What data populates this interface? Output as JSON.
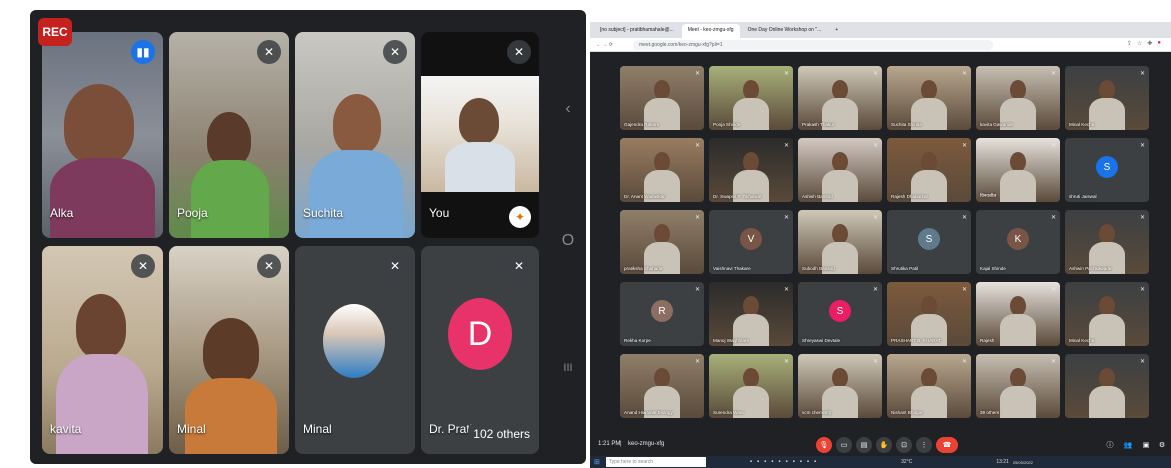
{
  "phone": {
    "rec_label": "REC",
    "tiles": [
      {
        "name": "Alka",
        "icon": "speaking-icon"
      },
      {
        "name": "Pooja",
        "icon": "mic-off-icon"
      },
      {
        "name": "Suchita",
        "icon": "mic-off-icon"
      },
      {
        "name": "You",
        "icon": "mic-off-icon"
      },
      {
        "name": "kavita",
        "icon": "mic-off-icon"
      },
      {
        "name": "Minal",
        "icon": "mic-off-icon"
      },
      {
        "name": "Minal",
        "icon": "mic-off-icon"
      },
      {
        "name": "Dr. Pratib",
        "icon": "mic-off-icon",
        "avatar_letter": "D"
      }
    ],
    "others_label": "102 others",
    "nav": {
      "back": "‹",
      "home": "O",
      "recents": "III"
    }
  },
  "desktop": {
    "tabs": [
      {
        "label": "[no subject] - pratibhamahale@..."
      },
      {
        "label": "Meet - keo-zmgu-xfg",
        "active": true
      },
      {
        "label": "One Day Online Workshop on \"..."
      }
    ],
    "url": "meet.google.com/keo-zmgu-xfg?pli=1",
    "participants": [
      {
        "name": "Gajendra Rahore"
      },
      {
        "name": "Pooja Shinde"
      },
      {
        "name": "Prakash Thakur"
      },
      {
        "name": "Suchita Shinde"
      },
      {
        "name": "kavita Gawande"
      },
      {
        "name": "Minal Keche",
        "avatar_color": "#2f2f2f"
      },
      {
        "name": "Dr. Anant Wadaskar"
      },
      {
        "name": "Dr. Swapnil P. Tikhande"
      },
      {
        "name": "Ashish Bansod"
      },
      {
        "name": "Rajesh Dhabarkar"
      },
      {
        "name": "विनयशील"
      },
      {
        "name": "shruti Jaiswal",
        "avatar_letter": "S",
        "avatar_color": "#1a73e8"
      },
      {
        "name": "pratiksha Shahade"
      },
      {
        "name": "Vaishnavi Thakare",
        "avatar_letter": "V",
        "avatar_color": "#795548"
      },
      {
        "name": "Subodh Bansod"
      },
      {
        "name": "Shrutika Patil",
        "avatar_letter": "S",
        "avatar_color": "#5f7a8a"
      },
      {
        "name": "Kajal Shinde",
        "avatar_letter": "K",
        "avatar_color": "#795548"
      },
      {
        "name": "Ashwin Pachkawade"
      },
      {
        "name": "Rekha Korpe",
        "avatar_letter": "R",
        "avatar_color": "#8d6e63"
      },
      {
        "name": "Manoj Waghmare"
      },
      {
        "name": "Shreyaswi Devtale",
        "avatar_letter": "S",
        "avatar_color": "#e91e63"
      },
      {
        "name": "PRASHANT B. KHARAT"
      },
      {
        "name": "Rajesh"
      },
      {
        "name": "Minal Keche"
      },
      {
        "name": "Anand Hiwarale Biology"
      },
      {
        "name": "Surendra Wani"
      },
      {
        "name": "vcm chemistry"
      },
      {
        "name": "Nishant Bhagat"
      },
      {
        "name": "39 others"
      },
      {
        "name": ""
      }
    ],
    "meeting_time": "1:21 PM",
    "meeting_code": "keo-zmgu-xfg",
    "search_placeholder": "Type here to search",
    "weather": "32°C",
    "clock": "13:21",
    "date": "25/05/2022"
  },
  "colors": {
    "meet_bg": "#202124",
    "tile_bg": "#3c4043",
    "end_call": "#ea4335",
    "rec": "#c5221f"
  }
}
